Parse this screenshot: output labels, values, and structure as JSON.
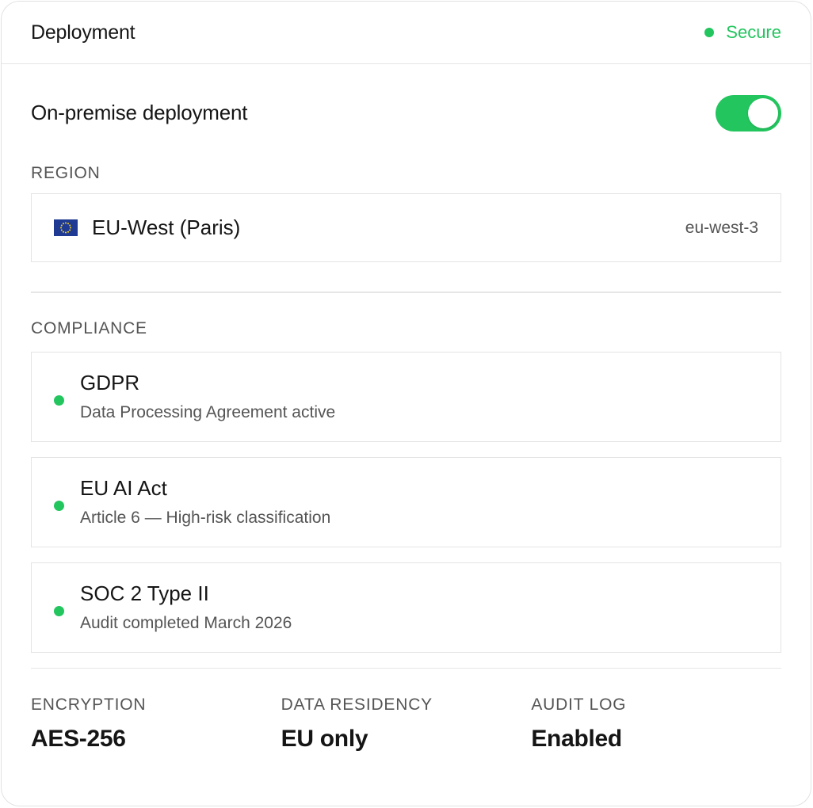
{
  "header": {
    "title": "Deployment",
    "status_label": "Secure"
  },
  "colors": {
    "accent_green": "#22c55e"
  },
  "toggle": {
    "label": "On-premise deployment",
    "state": "on"
  },
  "region": {
    "section_label": "REGION",
    "flag_icon": "eu-flag-icon",
    "name": "EU-West (Paris)",
    "code": "eu-west-3"
  },
  "compliance": {
    "section_label": "COMPLIANCE",
    "items": [
      {
        "title": "GDPR",
        "subtitle": "Data Processing Agreement active"
      },
      {
        "title": "EU AI Act",
        "subtitle": "Article 6 — High-risk classification"
      },
      {
        "title": "SOC 2 Type II",
        "subtitle": "Audit completed March 2026"
      }
    ]
  },
  "stats": [
    {
      "label": "ENCRYPTION",
      "value": "AES-256"
    },
    {
      "label": "DATA RESIDENCY",
      "value": "EU only"
    },
    {
      "label": "AUDIT LOG",
      "value": "Enabled"
    }
  ]
}
